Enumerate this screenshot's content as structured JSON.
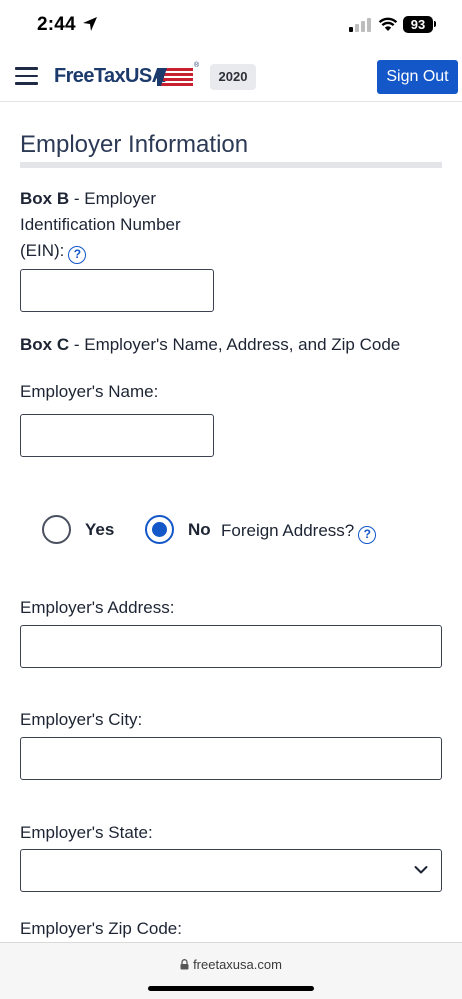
{
  "status_bar": {
    "time": "2:44",
    "battery": "93"
  },
  "header": {
    "logo_text": "FreeTaxUSA",
    "logo_tm": "®",
    "year": "2020",
    "sign_out_label": "Sign Out"
  },
  "form": {
    "title": "Employer Information",
    "box_b": {
      "bold": "Box B",
      "line1": " - Employer",
      "line2": "Identification Number",
      "line3": "(EIN):",
      "help": "?",
      "value": ""
    },
    "box_c": {
      "bold": "Box C",
      "rest": " - Employer's Name, Address, and Zip Code"
    },
    "employer_name": {
      "label": "Employer's Name:",
      "value": ""
    },
    "foreign_address": {
      "yes_label": "Yes",
      "no_label": "No",
      "selected": "No",
      "question": "Foreign Address?",
      "help": "?"
    },
    "employer_address": {
      "label": "Employer's Address:",
      "value": ""
    },
    "employer_city": {
      "label": "Employer's City:",
      "value": ""
    },
    "employer_state": {
      "label": "Employer's State:",
      "value": ""
    },
    "employer_zip": {
      "label": "Employer's Zip Code:"
    }
  },
  "browser": {
    "url": "freetaxusa.com"
  },
  "colors": {
    "accent": "#1357c9",
    "logo_navy": "#1c3a6b",
    "logo_red": "#c8202f"
  }
}
